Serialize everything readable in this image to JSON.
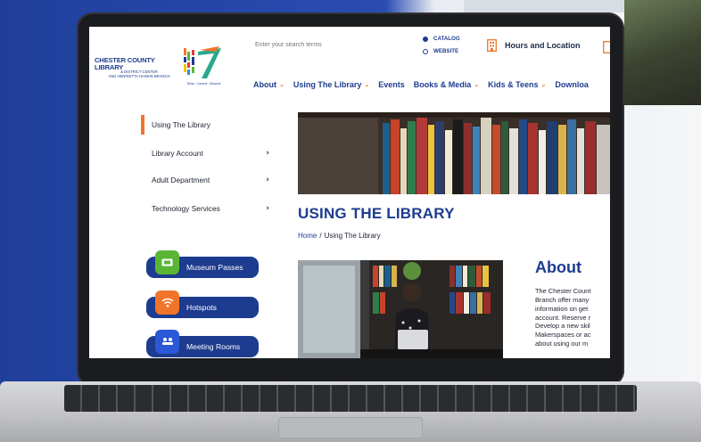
{
  "header": {
    "logo_title": "CHESTER COUNTY LIBRARY",
    "logo_subtitle_1": "& DISTRICT CENTER",
    "logo_subtitle_2": "AND HENRIETTA HANKIN BRANCH",
    "logo_tagline": "Read · Connect · Discover",
    "search_placeholder": "Enter your search terms",
    "search_scope": [
      {
        "label": "CATALOG",
        "selected": true
      },
      {
        "label": "WEBSITE",
        "selected": false
      }
    ],
    "hours_label": "Hours and Location"
  },
  "nav": [
    {
      "label": "About",
      "caret": "⌄"
    },
    {
      "label": "Using The Library",
      "caret": "⌄"
    },
    {
      "label": "Events",
      "caret": ""
    },
    {
      "label": "Books & Media",
      "caret": "⌄"
    },
    {
      "label": "Kids & Teens",
      "caret": "⌄"
    },
    {
      "label": "Downloa",
      "caret": ""
    }
  ],
  "sidebar": {
    "items": [
      {
        "label": "Using The Library",
        "active": true,
        "chevron": ""
      },
      {
        "label": "Library Account",
        "active": false,
        "chevron": "›"
      },
      {
        "label": "Adult Department",
        "active": false,
        "chevron": "›"
      },
      {
        "label": "Technology Services",
        "active": false,
        "chevron": "›"
      }
    ],
    "quick_links": [
      {
        "label": "Museum Passes",
        "icon": "ticket-icon",
        "color": "#5bb534"
      },
      {
        "label": "Hotspots",
        "icon": "wifi-icon",
        "color": "#f0752b"
      },
      {
        "label": "Meeting Rooms",
        "icon": "meeting-icon",
        "color": "#2a58d6"
      }
    ]
  },
  "main": {
    "title": "USING THE LIBRARY",
    "breadcrumb_home": "Home",
    "breadcrumb_sep": "/",
    "breadcrumb_current": "Using The Library",
    "about_heading": "About",
    "about_lines": [
      "The Chester Count",
      "Branch offer many",
      "information on get",
      "account. Reserve r",
      "Develop a new skil",
      "Makerspaces or ac",
      "about using our m"
    ]
  },
  "colors": {
    "brand_blue": "#1d3c8f",
    "accent_orange": "#f0752b"
  }
}
